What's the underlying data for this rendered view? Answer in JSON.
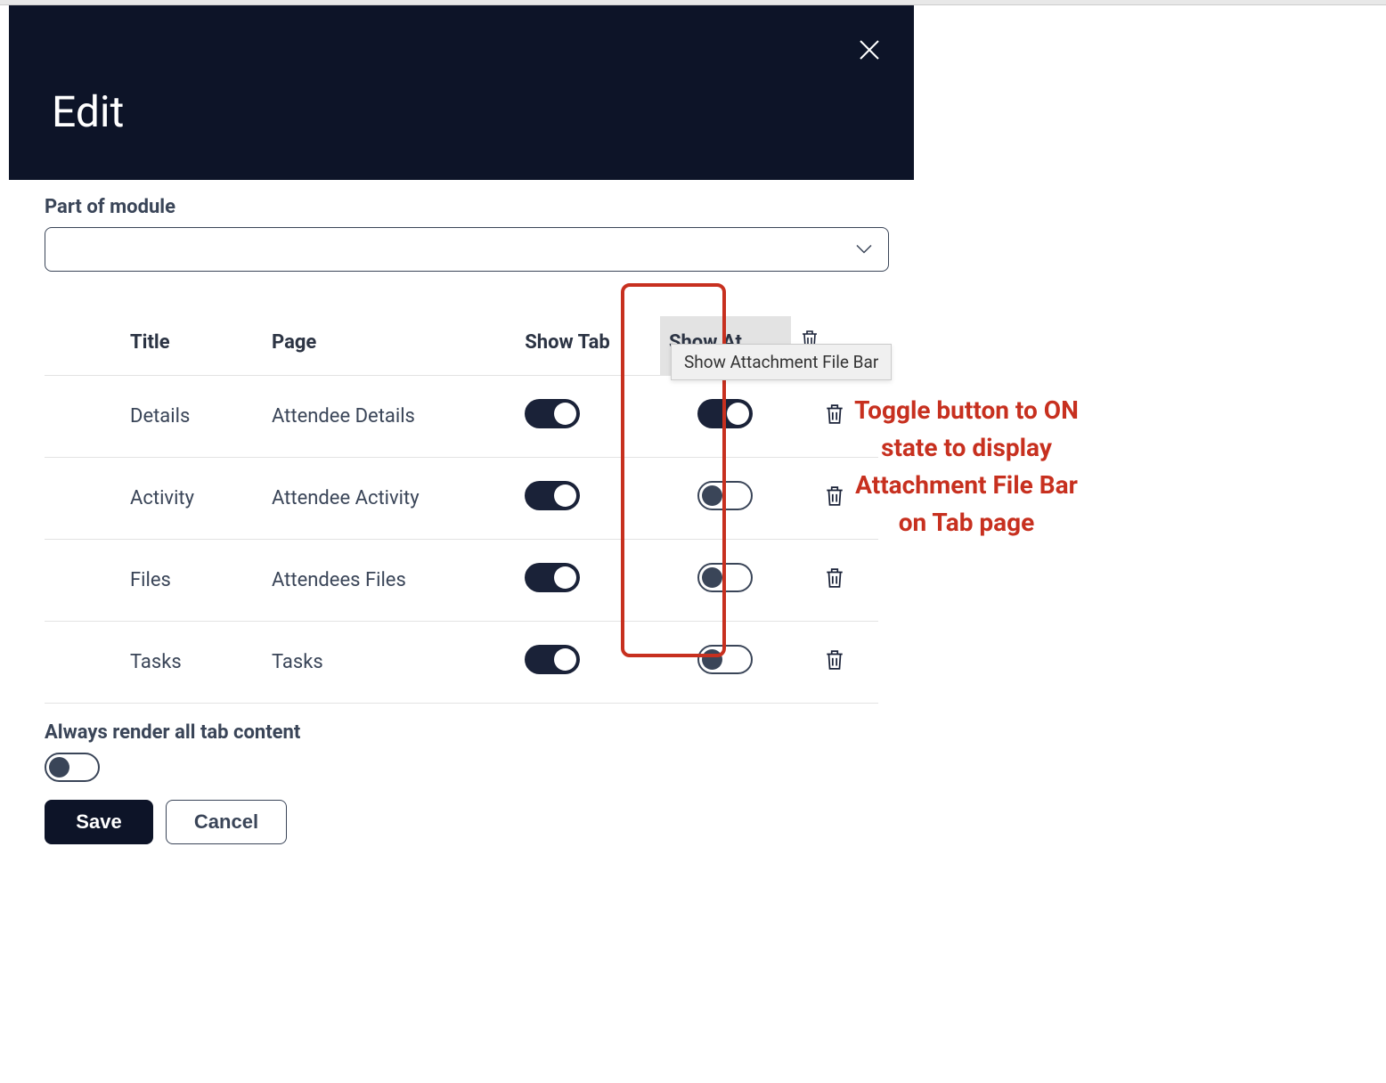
{
  "header": {
    "title": "Edit"
  },
  "fields": {
    "module_label": "Part of module",
    "module_value": ""
  },
  "table": {
    "headers": {
      "title": "Title",
      "page": "Page",
      "show_tab": "Show Tab",
      "show_att": "Show At..."
    },
    "rows": [
      {
        "title": "Details",
        "page": "Attendee Details",
        "show_tab": true,
        "show_att": true
      },
      {
        "title": "Activity",
        "page": "Attendee Activity",
        "show_tab": true,
        "show_att": false
      },
      {
        "title": "Files",
        "page": "Attendees Files",
        "show_tab": true,
        "show_att": false
      },
      {
        "title": "Tasks",
        "page": "Tasks",
        "show_tab": true,
        "show_att": false
      }
    ]
  },
  "always_render": {
    "label": "Always render all tab content",
    "value": false
  },
  "buttons": {
    "save": "Save",
    "cancel": "Cancel"
  },
  "tooltip": "Show Attachment File Bar",
  "annotation": "Toggle button to ON state to display Attachment File Bar on Tab page"
}
